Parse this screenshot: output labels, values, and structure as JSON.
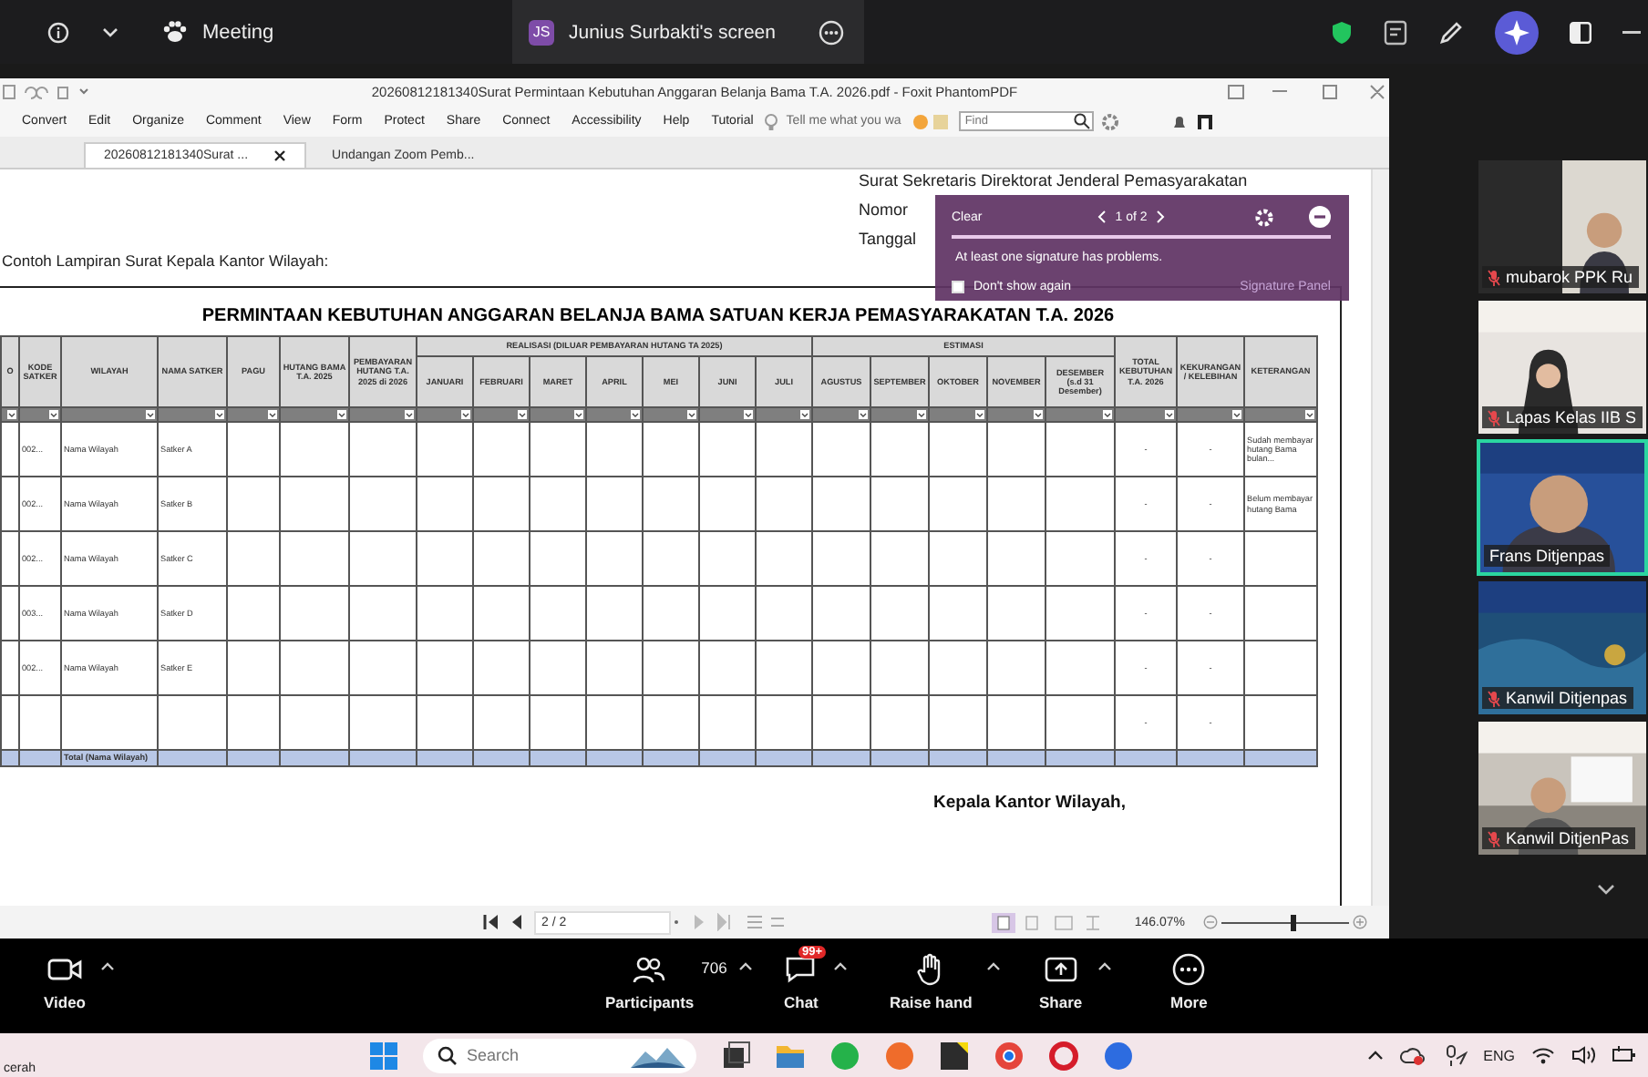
{
  "top_bar": {
    "meeting_label": "Meeting",
    "share_initials": "JS",
    "share_label": "Junius Surbakti's screen"
  },
  "pdf_window": {
    "title": "20260812181340Surat Permintaan Kebutuhan Anggaran Belanja Bama T.A. 2026.pdf - Foxit PhantomPDF",
    "menu": [
      "Convert",
      "Edit",
      "Organize",
      "Comment",
      "View",
      "Form",
      "Protect",
      "Share",
      "Connect",
      "Accessibility",
      "Help",
      "Tutorial"
    ],
    "tell_me": "Tell me what you wa",
    "find_placeholder": "Find",
    "tabs": [
      {
        "label": "20260812181340Surat ...",
        "selected": true
      },
      {
        "label": "Undangan Zoom Pemb...",
        "selected": false
      }
    ],
    "page_field": "2 / 2",
    "zoom_reading": "146.07%",
    "zoom_slider": {
      "level": 0.57
    }
  },
  "document": {
    "letter_from": "Surat Sekretaris Direktorat Jenderal Pemasyarakatan",
    "letter_fields": [
      "Nomor",
      "Tanggal"
    ],
    "intro": "Contoh Lampiran Surat Kepala Kantor Wilayah:",
    "table_title": "PERMINTAAN KEBUTUHAN ANGGARAN BELANJA BAMA SATUAN KERJA PEMASYARAKATAN T.A. 2026",
    "columns": [
      {
        "label": "O"
      },
      {
        "label": "KODE SATKER"
      },
      {
        "label": "WILAYAH"
      },
      {
        "label": "NAMA SATKER"
      },
      {
        "label": "PAGU"
      },
      {
        "label": "HUTANG BAMA T.A. 2025"
      },
      {
        "label": "PEMBAYARAN HUTANG T.A. 2025 di 2026"
      },
      {
        "label": "REALISASI (DILUAR PEMBAYARAN HUTANG TA 2025)",
        "children": [
          "JANUARI",
          "FEBRUARI",
          "MARET",
          "APRIL",
          "MEI",
          "JUNI",
          "JULI"
        ]
      },
      {
        "label": "ESTIMASI",
        "children": [
          "AGUSTUS",
          "SEPTEMBER",
          "OKTOBER",
          "NOVEMBER",
          "DESEMBER (s.d 31 Desember)"
        ]
      },
      {
        "label": "TOTAL KEBUTUHAN T.A. 2026"
      },
      {
        "label": "KEKURANGAN / KELEBIHAN"
      },
      {
        "label": "KETERANGAN"
      }
    ],
    "rows": [
      {
        "kode": "002...",
        "wilayah": "Nama Wilayah",
        "satker": "Satker A",
        "total": "-",
        "selisih": "-",
        "keterangan": "Sudah membayar hutang Bama bulan..."
      },
      {
        "kode": "002...",
        "wilayah": "Nama Wilayah",
        "satker": "Satker B",
        "total": "-",
        "selisih": "-",
        "keterangan": "Belum membayar hutang Bama"
      },
      {
        "kode": "002...",
        "wilayah": "Nama Wilayah",
        "satker": "Satker C",
        "total": "-",
        "selisih": "-"
      },
      {
        "kode": "003...",
        "wilayah": "Nama Wilayah",
        "satker": "Satker D",
        "total": "-",
        "selisih": "-"
      },
      {
        "kode": "002...",
        "wilayah": "Nama Wilayah",
        "satker": "Satker E",
        "total": "-",
        "selisih": "-"
      },
      {
        "total": "-",
        "selisih": "-"
      }
    ],
    "total_label": "Total (Nama Wilayah)",
    "signature": "Kepala Kantor Wilayah,"
  },
  "signature_popup": {
    "clear": "Clear",
    "counter": "1 of 2",
    "message": "At least one signature has problems.",
    "dont_show": {
      "label": "Don't show again",
      "checked": false
    },
    "link": "Signature Panel"
  },
  "participants": [
    {
      "name": "mubarok PPK Ru",
      "muted": true,
      "active": false
    },
    {
      "name": "Lapas Kelas IIB S",
      "muted": true,
      "active": false
    },
    {
      "name": "Frans Ditjenpas",
      "muted": false,
      "active": true
    },
    {
      "name": "Kanwil Ditjenpas",
      "muted": true,
      "active": false
    },
    {
      "name": "Kanwil DitjenPas",
      "muted": true,
      "active": false
    }
  ],
  "meeting_toolbar": [
    {
      "kind": "video",
      "label": "Video",
      "caret": true
    },
    {
      "kind": "participants",
      "label": "Participants",
      "count": "706",
      "caret": true
    },
    {
      "kind": "chat",
      "label": "Chat",
      "badge": "99+",
      "caret": true
    },
    {
      "kind": "raise_hand",
      "label": "Raise hand",
      "caret": true
    },
    {
      "kind": "share",
      "label": "Share",
      "caret": true
    },
    {
      "kind": "more",
      "label": "More",
      "caret": false
    }
  ],
  "taskbar": {
    "weather": "cerah",
    "search_placeholder": "Search",
    "apps": [
      {
        "kind": "start"
      },
      {
        "kind": "search"
      },
      {
        "kind": "task_view"
      },
      {
        "kind": "folder"
      },
      {
        "kind": "whatsapp"
      },
      {
        "kind": "firefox"
      },
      {
        "kind": "note"
      },
      {
        "kind": "chrome"
      },
      {
        "kind": "opera"
      },
      {
        "kind": "zoom"
      }
    ],
    "language": "ENG"
  }
}
